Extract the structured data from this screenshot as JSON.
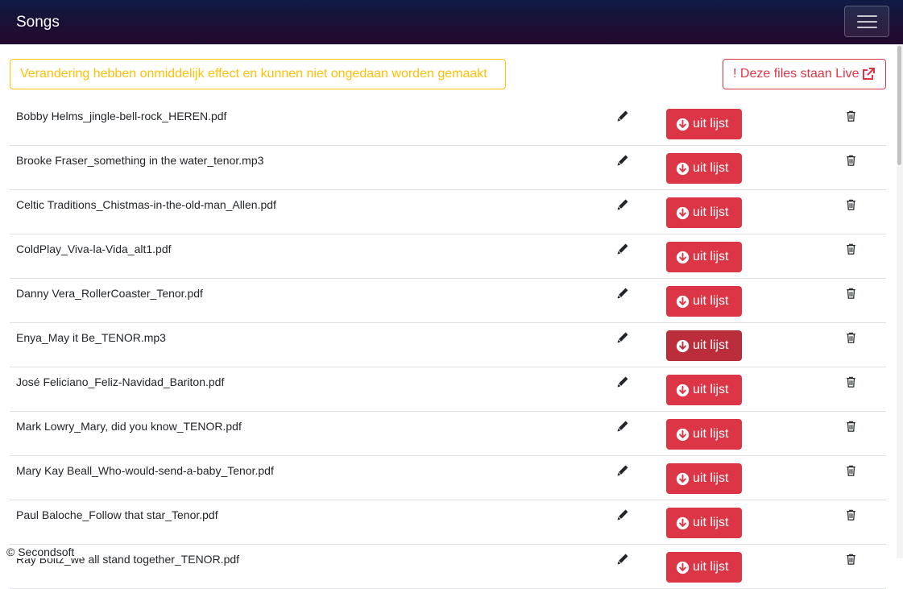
{
  "navbar": {
    "brand": "Songs",
    "toggler_icon": "hamburger-icon"
  },
  "notice": {
    "warning_text": "Verandering hebben onmiddelijk effect en kunnen niet ongedaan worden gemaakt",
    "live_label": "! Deze files staan Live",
    "live_icon": "external-link-icon"
  },
  "songs": {
    "remove_label": "uit lijst",
    "remove_icon": "arrow-circle-down-icon",
    "edit_icon": "pencil-icon",
    "delete_icon": "trash-icon",
    "rows": [
      {
        "filename": "Bobby Helms_jingle-bell-rock_HEREN.pdf"
      },
      {
        "filename": "Brooke Fraser_something in the water_tenor.mp3"
      },
      {
        "filename": "Celtic Traditions_Chistmas-in-the-old-man_Allen.pdf"
      },
      {
        "filename": "ColdPlay_Viva-la-Vida_alt1.pdf"
      },
      {
        "filename": "Danny Vera_RollerCoaster_Tenor.pdf"
      },
      {
        "filename": "Enya_May it Be_TENOR.mp3"
      },
      {
        "filename": "José Feliciano_Feliz-Navidad_Bariton.pdf"
      },
      {
        "filename": "Mark Lowry_Mary, did you know_TENOR.pdf"
      },
      {
        "filename": "Mary Kay Beall_Who-would-send-a-baby_Tenor.pdf"
      },
      {
        "filename": "Paul Baloche_Follow that star_Tenor.pdf"
      },
      {
        "filename": "Ray Boltz_we all stand together_TENOR.pdf"
      }
    ]
  },
  "footer": {
    "text": "© Secondsoft"
  },
  "colors": {
    "danger": "#dc3545",
    "danger_active": "#bb2d3b",
    "warning": "#ffc107",
    "navbar_gradient_start": "#0f1b45",
    "navbar_gradient_end": "#220a2e"
  }
}
